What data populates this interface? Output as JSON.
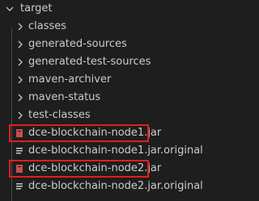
{
  "explorer": {
    "root": {
      "label": "target",
      "expanded": true
    },
    "folders": [
      {
        "label": "classes"
      },
      {
        "label": "generated-sources"
      },
      {
        "label": "generated-test-sources"
      },
      {
        "label": "maven-archiver"
      },
      {
        "label": "maven-status"
      },
      {
        "label": "test-classes"
      }
    ],
    "files": [
      {
        "label": "dce-blockchain-node1.jar",
        "icon": "jar-file-icon",
        "highlighted": true
      },
      {
        "label": "dce-blockchain-node1.jar.original",
        "icon": "text-file-icon",
        "highlighted": false
      },
      {
        "label": "dce-blockchain-node2.jar",
        "icon": "jar-file-icon",
        "highlighted": true
      },
      {
        "label": "dce-blockchain-node2.jar.original",
        "icon": "text-file-icon",
        "highlighted": false
      }
    ]
  },
  "colors": {
    "background": "#1e1e1e",
    "text": "#cccccc",
    "chevron": "#c5c5c5",
    "indent_guide": "#4a4a4a",
    "jar_icon": "#c5504b",
    "text_icon": "#c5c5c5",
    "highlight_border": "#e51c1c"
  }
}
